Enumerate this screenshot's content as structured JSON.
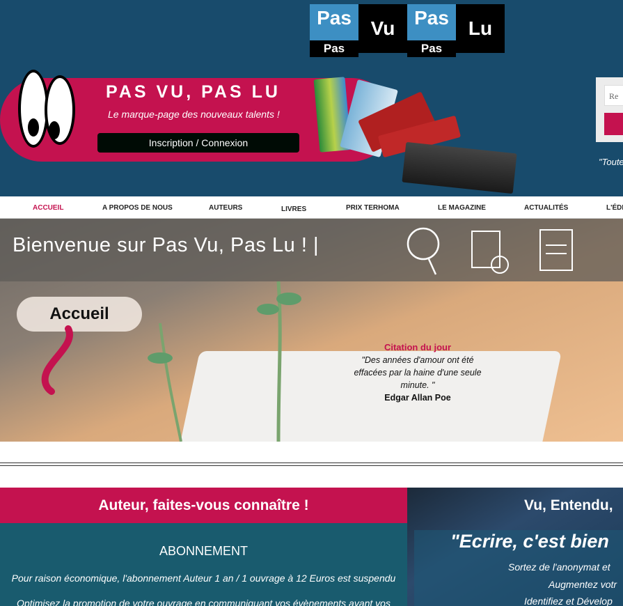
{
  "logo": {
    "blocks": [
      {
        "top": "Pas",
        "bottom": "Pas"
      },
      {
        "top": "Vu"
      },
      {
        "top": "Pas",
        "bottom": "Pas"
      },
      {
        "top": "Lu"
      }
    ]
  },
  "brand": {
    "title": "PAS VU, PAS LU",
    "subtitle": "Le marque-page des nouveaux talents !",
    "login": "Inscription / Connexion"
  },
  "search": {
    "placeholder": "Re"
  },
  "header_quote": "\"Toute",
  "nav": [
    "ACCUEIL",
    "A PROPOS DE NOUS",
    "AUTEURS",
    "LIVRES",
    "PRIX TERHOMA",
    "LE MAGAZINE",
    "ACTUALITÉS",
    "L'ÉDI"
  ],
  "hero": {
    "title": "Bienvenue sur  Pas Vu, Pas Lu ! |",
    "page_label": "Accueil",
    "citation": {
      "title": "Citation du jour",
      "text": "\"Des années d'amour ont été effacées par la haine d'une seule minute. \"",
      "author": "Edgar Allan Poe"
    }
  },
  "left": {
    "heading": "Auteur, faites-vous connaître !",
    "subheading": "ABONNEMENT",
    "line1": "Pour raison économique, l'abonnement Auteur 1 an / 1 ouvrage à 12 Euros est suspendu",
    "line2": "Optimisez la promotion de votre ouvrage en communiquant vos évènements avant vos"
  },
  "right": {
    "heading": "Vu, Entendu,",
    "quote": "\"Ecrire, c'est bien",
    "lines": [
      "Sortez de l'anonymat et",
      "Augmentez votr",
      "Identifiez et Dévelop"
    ]
  },
  "colors": {
    "header": "#184b6c",
    "accent": "#c4124f",
    "teal": "#195b6e"
  }
}
